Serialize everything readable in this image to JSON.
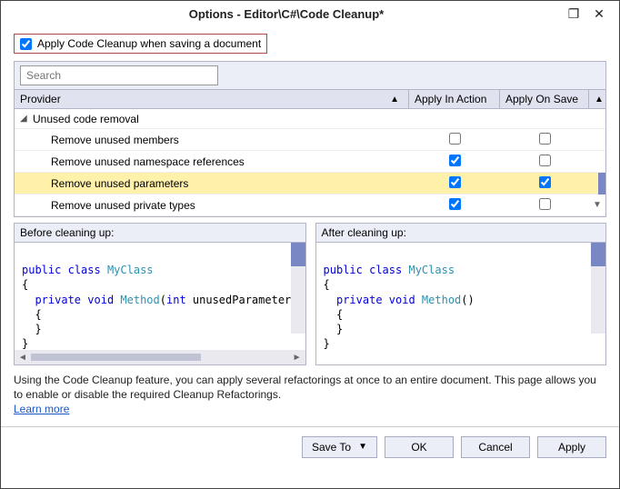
{
  "titlebar": {
    "title": "Options - Editor\\C#\\Code Cleanup*"
  },
  "applyOnSave": {
    "label": "Apply Code Cleanup when saving a document",
    "checked": true
  },
  "search": {
    "placeholder": "Search"
  },
  "columns": {
    "provider": "Provider",
    "action": "Apply In Action",
    "save": "Apply On Save"
  },
  "group": {
    "name": "Unused code removal"
  },
  "rows": [
    {
      "label": "Remove unused members",
      "action": false,
      "save": false,
      "selected": false
    },
    {
      "label": "Remove unused namespace references",
      "action": true,
      "save": false,
      "selected": false
    },
    {
      "label": "Remove unused parameters",
      "action": true,
      "save": true,
      "selected": true
    },
    {
      "label": "Remove unused private types",
      "action": true,
      "save": false,
      "selected": false
    }
  ],
  "preview": {
    "beforeTitle": "Before cleaning up:",
    "afterTitle": "After cleaning up:",
    "before": {
      "l1a": "public",
      "l1b": "class",
      "l1c": "MyClass",
      "open1": "{",
      "l2a": "private",
      "l2b": "void",
      "l2c": "Method",
      "l2d": "(",
      "l2e": "int",
      "l2f": " unusedParameter)",
      "open2": "{",
      "close2": "}",
      "close1": "}"
    },
    "after": {
      "l1a": "public",
      "l1b": "class",
      "l1c": "MyClass",
      "open1": "{",
      "l2a": "private",
      "l2b": "void",
      "l2c": "Method",
      "l2d": "()",
      "open2": "{",
      "close2": "}",
      "close1": "}"
    }
  },
  "help": {
    "text": "Using the Code Cleanup feature, you can apply several refactorings at once to an entire document. This page allows you to enable or disable the required Cleanup Refactorings.",
    "learn": "Learn more"
  },
  "buttons": {
    "saveTo": "Save To",
    "ok": "OK",
    "cancel": "Cancel",
    "apply": "Apply"
  }
}
